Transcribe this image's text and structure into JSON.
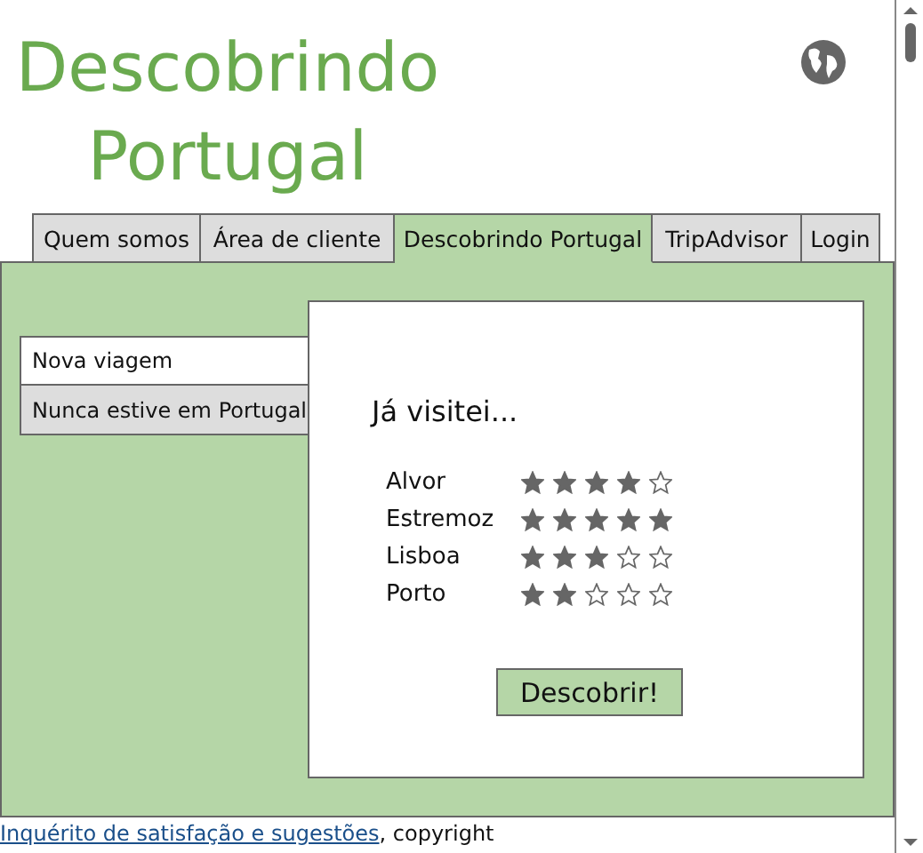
{
  "header": {
    "title": "Descobrindo Portugal"
  },
  "tabs": [
    {
      "label": "Quem somos",
      "selected": false
    },
    {
      "label": "Área de cliente",
      "selected": false
    },
    {
      "label": "Descobrindo Portugal",
      "selected": true
    },
    {
      "label": "TripAdvisor",
      "selected": false
    },
    {
      "label": "Login",
      "selected": false
    }
  ],
  "side_menu": [
    {
      "label": "Nova viagem",
      "selected": true
    },
    {
      "label": "Nunca estive em Portugal",
      "selected": false
    }
  ],
  "card": {
    "heading": "Já visitei...",
    "ratings": [
      {
        "place": "Alvor",
        "stars": 4
      },
      {
        "place": "Estremoz",
        "stars": 5
      },
      {
        "place": "Lisboa",
        "stars": 3
      },
      {
        "place": "Porto",
        "stars": 2
      }
    ],
    "button": "Descobrir!"
  },
  "footer": {
    "link": "Inquérito de satisfação e sugestões",
    "text": ", copyright"
  }
}
